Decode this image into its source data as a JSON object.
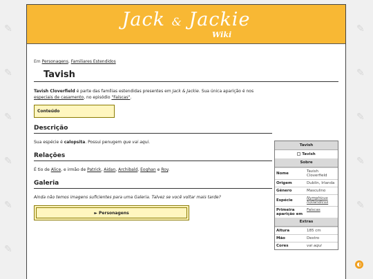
{
  "banner": {
    "logo_text": "Jack",
    "logo_amp": "&",
    "logo_text2": "Jackie",
    "logo_sub": "Wiki"
  },
  "breadcrumb": {
    "prefix": "Em",
    "link1": "Personagens",
    "sep": ",",
    "link2": "Familiares Estendidos"
  },
  "page_title": "Tavish",
  "intro": {
    "bold_name": "Tavish Cloverfield",
    "t1": " é parte das famílias estendidas presentes em ",
    "italic": "Jack & Jackie",
    "t2": ". Sua única aparição é nos ",
    "link1": "especiais de casamento",
    "t3": ", no episódio ",
    "link2": "\"Faíscas\"",
    "t4": "."
  },
  "toc_label": "Conteúdo",
  "sections": {
    "descricao": {
      "heading": "Descrição",
      "t1": "Sua espécie é ",
      "bold": "calopsita",
      "t2": ". Possui penugem ",
      "italic": "que vai aqui",
      "t3": "."
    },
    "relacoes": {
      "heading": "Relações",
      "t1": "É tio de ",
      "l1": "Alice",
      "t2": ", e irmão de ",
      "l2": "Patrick",
      "c1": ", ",
      "l3": "Aidan",
      "c2": ", ",
      "l4": "Archibald",
      "c3": ", ",
      "l5": "Eoghan",
      "t3": " e ",
      "l6": "Roy",
      "t4": "."
    },
    "galeria": {
      "heading": "Galeria",
      "text": "Ainda não temos imagens suficientes para uma Galeria. Talvez se você voltar mais tarde?"
    }
  },
  "nav_box_label": "► Personagens",
  "infobox": {
    "title": "Tavish",
    "image_alt": "Tavish",
    "sobre": "Sobre",
    "extras": "Extras",
    "rows": [
      {
        "k": "Nome",
        "v": "Tavish Cloverfield"
      },
      {
        "k": "Origem",
        "v": "Dublin, Irlanda"
      },
      {
        "k": "Gênero",
        "v": "Masculino"
      },
      {
        "k": "Espécie",
        "v": "Nymphicus hollandicus"
      },
      {
        "k": "Primeira aparição em",
        "v": "Faíscas"
      }
    ],
    "extra_rows": [
      {
        "k": "Altura",
        "v": "185 cm"
      },
      {
        "k": "Mão",
        "v": "Destro"
      },
      {
        "k": "Cores",
        "v": "vai aqui"
      }
    ]
  },
  "theme_toggle_icon": "◐",
  "bg_icon": "✎"
}
